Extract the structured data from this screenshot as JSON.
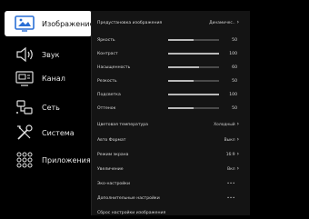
{
  "sidebar": {
    "items": [
      {
        "label": "Изображение",
        "icon": "picture-icon",
        "active": true
      },
      {
        "label": "Звук",
        "icon": "speaker-icon",
        "active": false
      },
      {
        "label": "Канал",
        "icon": "tv-channel-icon",
        "active": false
      },
      {
        "label": "Сеть",
        "icon": "network-icon",
        "active": false
      },
      {
        "label": "Система",
        "icon": "tools-icon",
        "active": false
      },
      {
        "label": "Приложения",
        "icon": "apps-grid-icon",
        "active": false
      }
    ]
  },
  "picture": {
    "preset": {
      "label": "Предустановка изображения",
      "value": "Динамичес.."
    },
    "sliders": [
      {
        "label": "Яркость",
        "value": 50,
        "max": 100
      },
      {
        "label": "Контраст",
        "value": 100,
        "max": 100
      },
      {
        "label": "Насыщенность",
        "value": 60,
        "max": 100
      },
      {
        "label": "Резкость",
        "value": 50,
        "max": 100
      },
      {
        "label": "Подсветка",
        "value": 100,
        "max": 100
      },
      {
        "label": "Оттенок",
        "value": 50,
        "max": 100
      }
    ],
    "options": [
      {
        "label": "Цветовая температура",
        "value": "Холодный"
      },
      {
        "label": "Авто Формат",
        "value": "Выкл"
      },
      {
        "label": "Режим экрана",
        "value": "16:9"
      },
      {
        "label": "Увеличение",
        "value": "Вкл"
      }
    ],
    "eco": {
      "label": "Эко-настройки",
      "value": "•••"
    },
    "advanced": {
      "label": "Дополнительные настройки",
      "value": "•••"
    },
    "reset": {
      "label": "Сброс настройки изображения"
    }
  },
  "colors": {
    "background": "#000000",
    "panel": "#141414",
    "active_item": "#ffffff",
    "slider_fill": "#b9b9b9",
    "slider_track": "#4a4a4a"
  }
}
